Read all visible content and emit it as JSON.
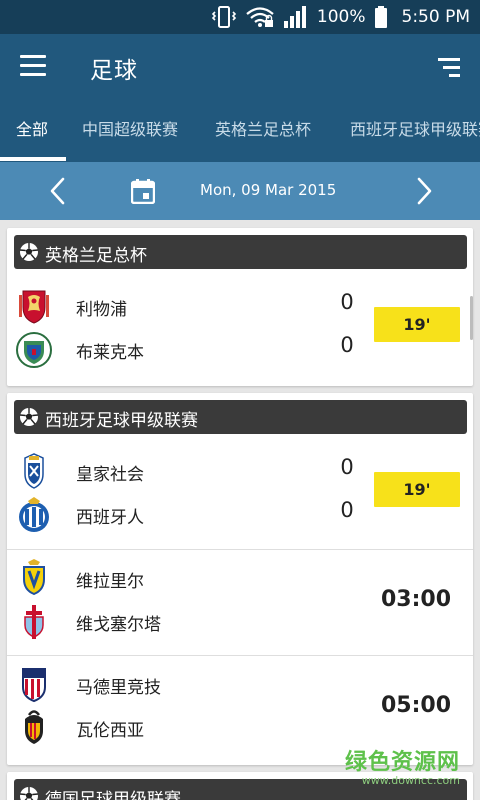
{
  "status_bar": {
    "battery": "100%",
    "time": "5:50 PM"
  },
  "app_bar": {
    "title": "足球"
  },
  "tabs": [
    {
      "label": "全部",
      "active": true
    },
    {
      "label": "中国超级联赛"
    },
    {
      "label": "英格兰足总杯"
    },
    {
      "label": "西班牙足球甲级联赛"
    }
  ],
  "date_bar": {
    "date": "Mon, 09 Mar 2015"
  },
  "leagues": [
    {
      "name": "英格兰足总杯",
      "matches": [
        {
          "home": "利物浦",
          "away": "布莱克本",
          "home_score": "0",
          "away_score": "0",
          "minute": "19'"
        }
      ]
    },
    {
      "name": "西班牙足球甲级联赛",
      "matches": [
        {
          "home": "皇家社会",
          "away": "西班牙人",
          "home_score": "0",
          "away_score": "0",
          "minute": "19'"
        },
        {
          "home": "维拉里尔",
          "away": "维戈塞尔塔",
          "kickoff": "03:00"
        },
        {
          "home": "马德里竞技",
          "away": "瓦伦西亚",
          "kickoff": "05:00"
        }
      ]
    },
    {
      "name": "德国足球甲级联赛"
    }
  ],
  "watermark": {
    "main": "绿色资源网",
    "sub": "www.downcc.com"
  },
  "colors": {
    "status_bar": "#163e58",
    "app_bar": "#21587d",
    "date_bar": "#4c8ab5",
    "live_badge": "#f7e11a",
    "league_header": "#3a3a3a"
  },
  "icons": {
    "menu": "hamburger-menu-icon",
    "sort": "sort-icon",
    "date_prev": "chevron-left-icon",
    "date_next": "chevron-right-icon",
    "calendar": "calendar-icon",
    "league": "soccer-ball-icon"
  }
}
